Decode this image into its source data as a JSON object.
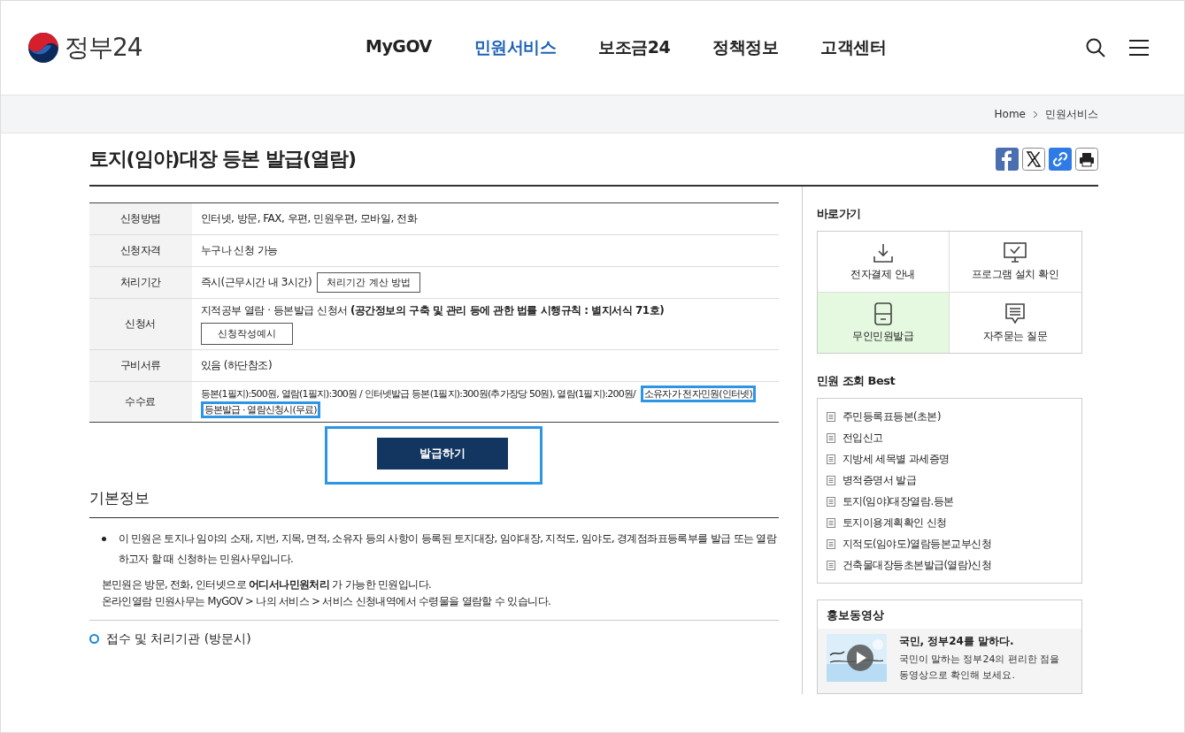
{
  "header": {
    "logo": "정부24",
    "nav": [
      {
        "label": "MyGOV",
        "selected": false
      },
      {
        "label": "민원서비스",
        "selected": true
      },
      {
        "label": "보조금24",
        "selected": false
      },
      {
        "label": "정책정보",
        "selected": false
      },
      {
        "label": "고객센터",
        "selected": false
      }
    ]
  },
  "breadcrumb": [
    "Home",
    "민원서비스"
  ],
  "page_title": "토지(임야)대장 등본 발급(열람)",
  "info_table": [
    {
      "label": "신청방법",
      "kind": "text",
      "value": "인터넷, 방문, FAX, 우편, 민원우편, 모바일, 전화"
    },
    {
      "label": "신청자격",
      "kind": "text",
      "value": "누구나 신청 가능"
    },
    {
      "label": "처리기간",
      "kind": "inline_button",
      "value": "즉시(근무시간 내 3시간)",
      "button": "처리기간 계산 방법"
    },
    {
      "label": "신청서",
      "kind": "block_button",
      "value": "지적공부 열람 · 등본발급 신청서 **(공간정보의 구축 및 관리 등에 관한 법률 시행규칙 : 별지서식 71호)**",
      "button": "신청작성예시"
    },
    {
      "label": "구비서류",
      "kind": "text",
      "value": "있음 (하단참조)"
    },
    {
      "label": "수수료",
      "kind": "highlight",
      "value": "등본(1필지):500원, 열람(1필지):300원 / 인터넷발급 등본(1필지):300원(추가장당 50원), 열람(1필지):200원/",
      "highlights": [
        "소유자가 전자민원(인터넷)",
        "등본발급 · 열람신청시(무료)"
      ]
    }
  ],
  "issue_button": {
    "label": "발급하기",
    "highlighted": true
  },
  "basic_info": {
    "heading": "기본정보",
    "bullet": "이 민원은 토지나 임야의 소재, 지번, 지목, 면적, 소유자 등의 사항이 등록된 토지대장, 임야대장, 지적도, 임야도, 경계점좌표등록부를 발급 또는 열람하고자 할 때 신청하는 민원사무입니다.",
    "paragraphs": [
      "본민원은 방문, 전화, 인터넷으로 **어디서나민원처리** 가 가능한 민원입니다.",
      "온라인열람 민원사무는 MyGOV > 나의 서비스 > 서비스 신청내역에서 수령물을 열람할 수 있습니다."
    ],
    "subheading": "접수 및 처리기관 (방문시)"
  },
  "sidebar": {
    "shortcuts_title": "바로가기",
    "shortcuts": [
      {
        "label": "전자결제 안내",
        "kind": "download",
        "selected": false
      },
      {
        "label": "프로그램 설치 확인",
        "kind": "monitor",
        "selected": false
      },
      {
        "label": "무인민원발급",
        "kind": "kiosk",
        "selected": true
      },
      {
        "label": "자주묻는 질문",
        "kind": "chat",
        "selected": false
      }
    ],
    "best_title": "민원 조회 Best",
    "best": [
      "주민등록표등본(초본)",
      "전입신고",
      "지방세 세목별 과세증명",
      "병적증명서 발급",
      "토지(임야)대장열람.등본",
      "토지이용계획확인 신청",
      "지적도(임야도)열람등본교부신청",
      "건축물대장등초본발급(열람)신청"
    ],
    "video_title": "홍보동영상",
    "video": {
      "kind": "picture",
      "title": "국민, 정부24를 말하다.",
      "desc": [
        "국민이 말하는 정부24의 편리한 점을",
        "동영상으로 확인해 보세요."
      ]
    }
  }
}
